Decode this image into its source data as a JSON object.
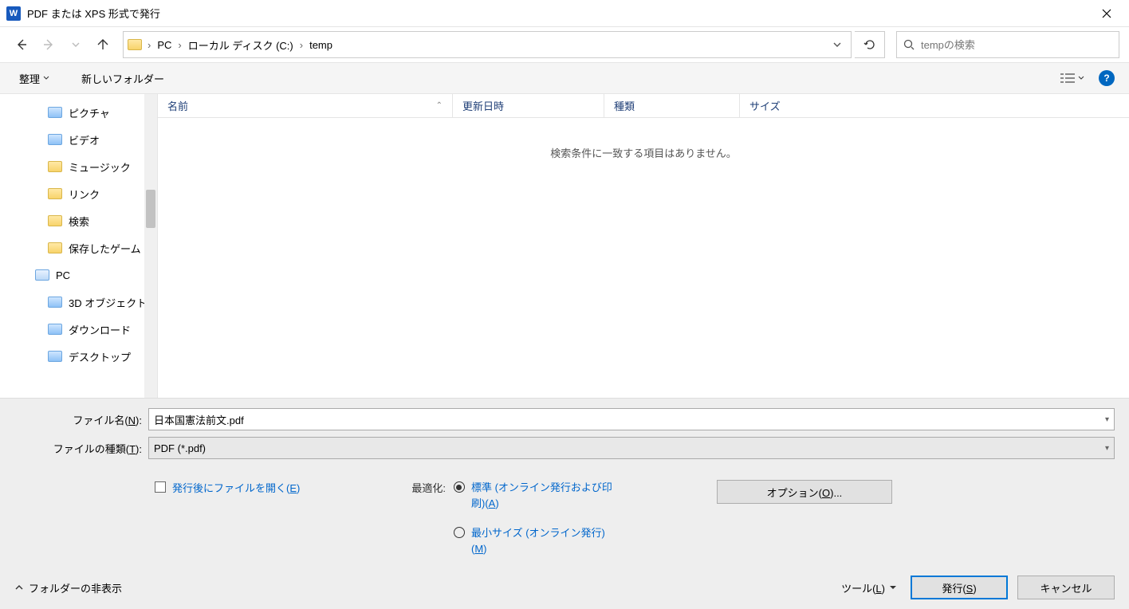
{
  "title": "PDF または XPS 形式で発行",
  "breadcrumbs": [
    "PC",
    "ローカル ディスク (C:)",
    "temp"
  ],
  "search_placeholder": "tempの検索",
  "toolbar": {
    "organize": "整理",
    "new_folder": "新しいフォルダー"
  },
  "sidebar": {
    "items": [
      {
        "label": "ピクチャ",
        "type": "folder-blue",
        "lvl": 1
      },
      {
        "label": "ビデオ",
        "type": "folder-blue",
        "lvl": 1
      },
      {
        "label": "ミュージック",
        "type": "folder",
        "lvl": 1
      },
      {
        "label": "リンク",
        "type": "folder",
        "lvl": 1
      },
      {
        "label": "検索",
        "type": "folder",
        "lvl": 1
      },
      {
        "label": "保存したゲーム",
        "type": "folder",
        "lvl": 1
      },
      {
        "label": "PC",
        "type": "pc",
        "lvl": 0
      },
      {
        "label": "3D オブジェクト",
        "type": "folder-blue",
        "lvl": 1
      },
      {
        "label": "ダウンロード",
        "type": "folder-blue",
        "lvl": 1
      },
      {
        "label": "デスクトップ",
        "type": "folder-blue",
        "lvl": 1
      }
    ]
  },
  "columns": {
    "name": "名前",
    "date": "更新日時",
    "type": "種類",
    "size": "サイズ"
  },
  "empty_msg": "検索条件に一致する項目はありません。",
  "filename_label_pre": "ファイル名(",
  "filename_label_u": "N",
  "filename_label_post": "):",
  "filename_value": "日本国憲法前文.pdf",
  "filetype_label_pre": "ファイルの種類(",
  "filetype_label_u": "T",
  "filetype_label_post": "):",
  "filetype_value": "PDF (*.pdf)",
  "open_after_pre": "発行後にファイルを開く(",
  "open_after_u": "E",
  "open_after_post": ")",
  "optimize_label": "最適化:",
  "radio1_pre": "標準 (オンライン発行および印刷)(",
  "radio1_u": "A",
  "radio1_post": ")",
  "radio2_pre": "最小サイズ (オンライン発行)(",
  "radio2_u": "M",
  "radio2_post": ")",
  "options_btn_pre": "オプション(",
  "options_btn_u": "O",
  "options_btn_post": ")...",
  "hide_folders": "フォルダーの非表示",
  "tools_pre": "ツール(",
  "tools_u": "L",
  "tools_post": ")",
  "publish_pre": "発行(",
  "publish_u": "S",
  "publish_post": ")",
  "cancel": "キャンセル"
}
